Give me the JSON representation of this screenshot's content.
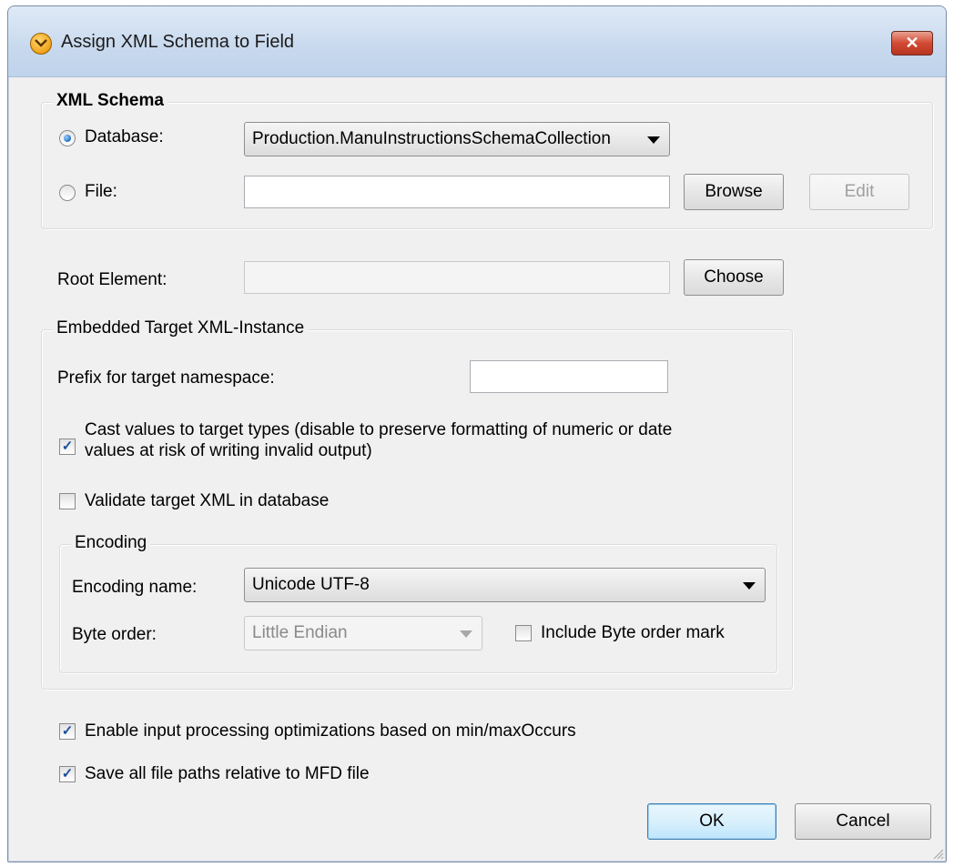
{
  "window": {
    "title": "Assign XML Schema to Field",
    "close_label": "✕"
  },
  "xml_schema": {
    "legend": "XML Schema",
    "database_label": "Database:",
    "database_value": "Production.ManuInstructionsSchemaCollection",
    "database_selected": true,
    "file_label": "File:",
    "file_value": "",
    "browse_label": "Browse",
    "edit_label": "Edit"
  },
  "root_element": {
    "label": "Root Element:",
    "value": "",
    "choose_label": "Choose"
  },
  "embedded": {
    "legend": "Embedded Target XML-Instance",
    "prefix_label": "Prefix for target namespace:",
    "prefix_value": "",
    "cast_label_line1": "Cast values to target types (disable to preserve formatting of numeric or date",
    "cast_label_line2": "values at risk of writing invalid output)",
    "cast_checked": true,
    "validate_label": "Validate target XML in database",
    "validate_checked": false,
    "encoding": {
      "legend": "Encoding",
      "name_label": "Encoding name:",
      "name_value": "Unicode UTF-8",
      "byte_order_label": "Byte order:",
      "byte_order_value": "Little Endian",
      "bom_label": "Include Byte order mark",
      "bom_checked": false
    }
  },
  "options": {
    "optimizations_label": "Enable input processing optimizations based on min/maxOccurs",
    "optimizations_checked": true,
    "relative_paths_label": "Save all file paths relative to MFD file",
    "relative_paths_checked": true
  },
  "footer": {
    "ok_label": "OK",
    "cancel_label": "Cancel"
  },
  "check_glyph": "✓"
}
